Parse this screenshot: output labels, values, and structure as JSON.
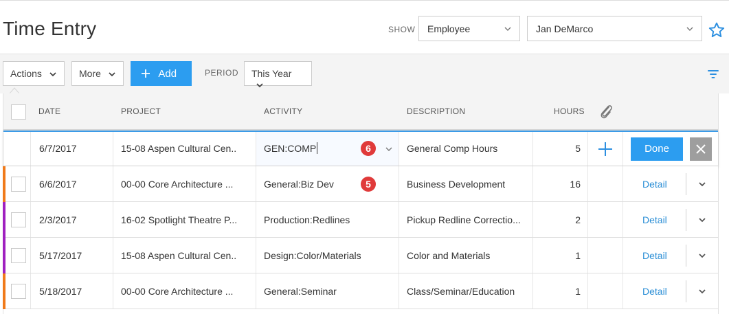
{
  "header": {
    "title": "Time Entry",
    "show_label": "SHOW",
    "show_select": "Employee",
    "person_select": "Jan DeMarco"
  },
  "toolbar": {
    "actions_label": "Actions",
    "more_label": "More",
    "add_label": "Add",
    "period_label": "PERIOD",
    "period_select": "This Year"
  },
  "table": {
    "columns": [
      "DATE",
      "PROJECT",
      "ACTIVITY",
      "DESCRIPTION",
      "HOURS"
    ],
    "edit_row": {
      "date": "6/7/2017",
      "project": "15-08 Aspen Cultural Cen..",
      "activity": "GEN:COMP",
      "description": "General Comp Hours",
      "hours": "5",
      "done_label": "Done",
      "badge": "6"
    },
    "rows": [
      {
        "date": "6/6/2017",
        "project": "00-00 Core Architecture ...",
        "activity": "General:Biz Dev",
        "description": "Business Development",
        "hours": "16",
        "link": "Detail",
        "stripe": "#f07a1a",
        "badge": "5"
      },
      {
        "date": "2/3/2017",
        "project": "16-02 Spotlight Theatre P...",
        "activity": "Production:Redlines",
        "description": "Pickup Redline Correctio...",
        "hours": "2",
        "link": "Detail",
        "stripe": "#a020c0"
      },
      {
        "date": "5/17/2017",
        "project": "15-08 Aspen Cultural Cen..",
        "activity": "Design:Color/Materials",
        "description": "Color and Materials",
        "hours": "1",
        "link": "Detail",
        "stripe": "#a020c0"
      },
      {
        "date": "5/18/2017",
        "project": "00-00 Core Architecture ...",
        "activity": "General:Seminar",
        "description": "Class/Seminar/Education",
        "hours": "1",
        "link": "Detail",
        "stripe": "#f07a1a"
      }
    ]
  },
  "colors": {
    "accent": "#2c9df0",
    "badge": "#e03a3a",
    "stripe_orange": "#f07a1a",
    "stripe_purple": "#a020c0"
  },
  "icons": [
    "chevron-down-icon",
    "star-icon",
    "plus-icon",
    "filter-icon",
    "paperclip-icon",
    "close-icon"
  ]
}
